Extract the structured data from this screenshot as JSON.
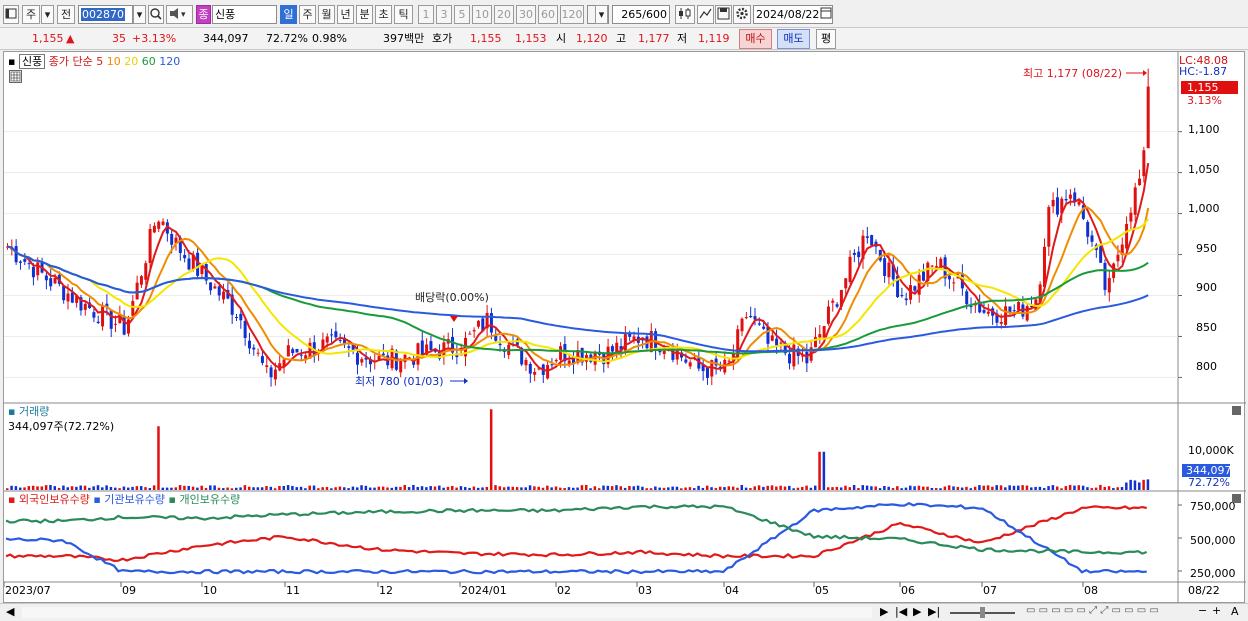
{
  "toolbar": {
    "mode_tabs": [
      "주",
      "전"
    ],
    "code": "002870",
    "name_badge": "종",
    "name": "신풍",
    "period_tabs": [
      "일",
      "주",
      "월",
      "년",
      "분",
      "초",
      "틱"
    ],
    "selected_period": "일",
    "interval_tabs": [
      "1",
      "3",
      "5",
      "10",
      "20",
      "30",
      "60",
      "120"
    ],
    "count": "265",
    "count_total": "/600",
    "date": "2024/08/22"
  },
  "quote": {
    "price": "1,155",
    "change_arrow": "▲",
    "change": "35",
    "change_pct": "+3.13%",
    "volume": "344,097",
    "volume_ratio": "72.72%",
    "turnover": "0.98%",
    "amount": "397백만",
    "ask_label": "호가",
    "ask": "1,155",
    "bid": "1,153",
    "open_label": "시",
    "open": "1,120",
    "high_label": "고",
    "high": "1,177",
    "low_label": "저",
    "low": "1,119",
    "buy_label": "매수",
    "sell_label": "매도",
    "eval_label": "평"
  },
  "price_panel": {
    "legend_name": "신풍",
    "legend_series": "종가 단순",
    "ma_periods": [
      "5",
      "10",
      "20",
      "60",
      "120"
    ],
    "ma_colors": [
      "#e01a1a",
      "#f08c00",
      "#f5e600",
      "#1a9a3a",
      "#2a5ae0"
    ],
    "lc_label": "LC:48.08",
    "hc_label": "HC:-1.87",
    "last_price_tag": "1,155",
    "last_pct_tag": "3.13%",
    "high_annotation": "최고 1,177 (08/22)",
    "low_annotation": "최저 780 (01/03)",
    "dividend_annotation": "배당락(0.00%)",
    "y_ticks": [
      "1,100",
      "1,050",
      "1,000",
      "950",
      "900",
      "850",
      "800"
    ]
  },
  "volume_panel": {
    "title": "거래량",
    "value_label": "344,097주(72.72%)",
    "y_tick": "10,000K",
    "last_tag": "344,097",
    "last_pct": "72.72%"
  },
  "holding_panel": {
    "series": [
      "외국인보유수량",
      "기관보유수량",
      "개인보유수량"
    ],
    "colors": [
      "#e01a1a",
      "#2a5ae0",
      "#2a8a5a"
    ],
    "y_ticks": [
      "750,000",
      "500,000",
      "250,000"
    ]
  },
  "x_axis": {
    "labels": [
      "2023/07",
      "09",
      "10",
      "11",
      "12",
      "2024/01",
      "02",
      "03",
      "04",
      "05",
      "06",
      "07",
      "08"
    ],
    "right_label": "08/22"
  },
  "chart_data": {
    "type": "line",
    "title": "",
    "xlabel": "",
    "ylabel": "",
    "price_ylim": [
      770,
      1185
    ],
    "price_close_approx": [
      [
        "2023/07",
        960
      ],
      [
        "2023/08",
        900
      ],
      [
        "2023/09",
        1000
      ],
      [
        "2023/10",
        920
      ],
      [
        "2023/11",
        840
      ],
      [
        "2023/12",
        840
      ],
      [
        "2024/01",
        850
      ],
      [
        "2024/02",
        830
      ],
      [
        "2024/03",
        840
      ],
      [
        "2024/04",
        810
      ],
      [
        "2024/05",
        870
      ],
      [
        "2024/06",
        900
      ],
      [
        "2024/07",
        880
      ],
      [
        "2024/08",
        1155
      ]
    ],
    "annotations": {
      "high": 1177,
      "high_date": "08/22",
      "low": 780,
      "low_date": "01/03"
    },
    "series": [
      {
        "name": "외국인보유수량",
        "values": [
          350000,
          350000,
          320000,
          430000,
          500000,
          400000,
          370000,
          360000,
          380000,
          350000,
          350000,
          600000,
          450000,
          720000
        ]
      },
      {
        "name": "기관보유수량",
        "values": [
          480000,
          470000,
          230000,
          230000,
          230000,
          230000,
          230000,
          230000,
          230000,
          230000,
          700000,
          750000,
          720000,
          230000
        ]
      },
      {
        "name": "개인보유수량",
        "values": [
          620000,
          620000,
          650000,
          640000,
          670000,
          690000,
          700000,
          700000,
          730000,
          730000,
          500000,
          480000,
          400000,
          380000
        ]
      }
    ]
  }
}
